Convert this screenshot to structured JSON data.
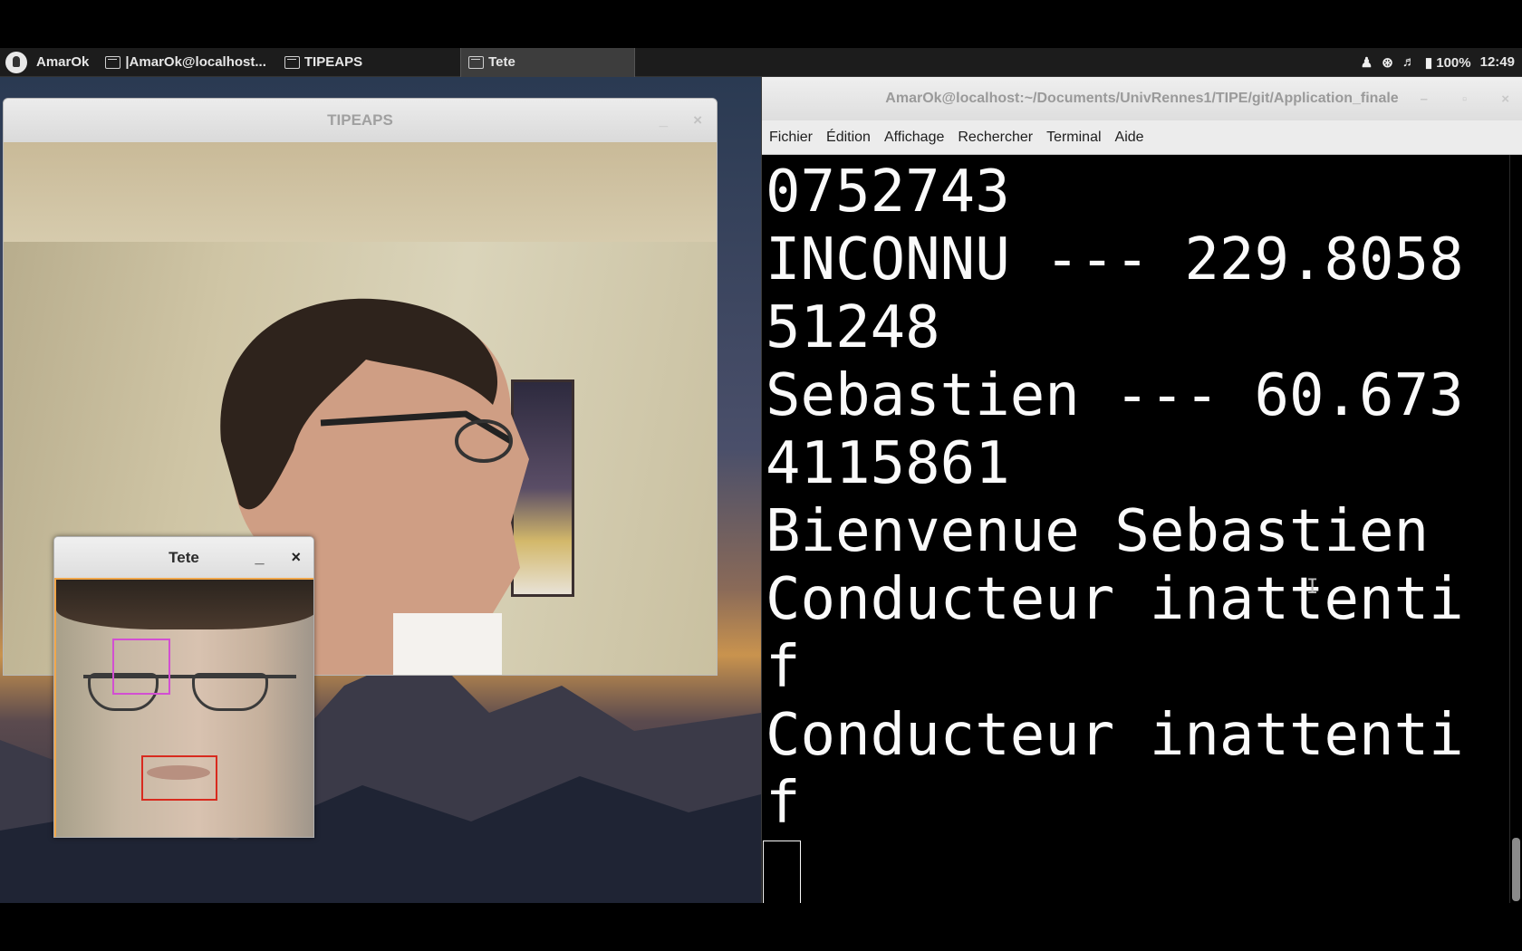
{
  "panel": {
    "menu_label": "AmarOk",
    "tasks": [
      {
        "label": "|AmarOk@localhost..."
      },
      {
        "label": "TIPEAPS"
      },
      {
        "label": "Tete"
      }
    ],
    "battery": "100%",
    "clock": "12:49"
  },
  "tipeaps_window": {
    "title": "TIPEAPS",
    "controls": [
      "_",
      "×"
    ]
  },
  "tete_window": {
    "title": "Tete",
    "controls": [
      "_",
      "×"
    ],
    "box_colors": {
      "eye": "#d24fd2",
      "mouth": "#d82a1e"
    }
  },
  "terminal": {
    "title": "AmarOk@localhost:~/Documents/UnivRennes1/TIPE/git/Application_finale",
    "controls": [
      "–",
      "▫",
      "×"
    ],
    "menu": [
      "Fichier",
      "Édition",
      "Affichage",
      "Rechercher",
      "Terminal",
      "Aide"
    ],
    "lines": [
      "0752743",
      "INCONNU --- 229.8058",
      "51248",
      "Sebastien --- 60.673",
      "4115861",
      "Bienvenue Sebastien",
      "Conducteur inattenti",
      "f",
      "Conducteur inattenti",
      "f"
    ]
  },
  "icons": [
    "app-menu-icon",
    "terminal-icon",
    "window-icon",
    "user-icon",
    "wifi-icon",
    "volume-icon",
    "battery-icon"
  ]
}
